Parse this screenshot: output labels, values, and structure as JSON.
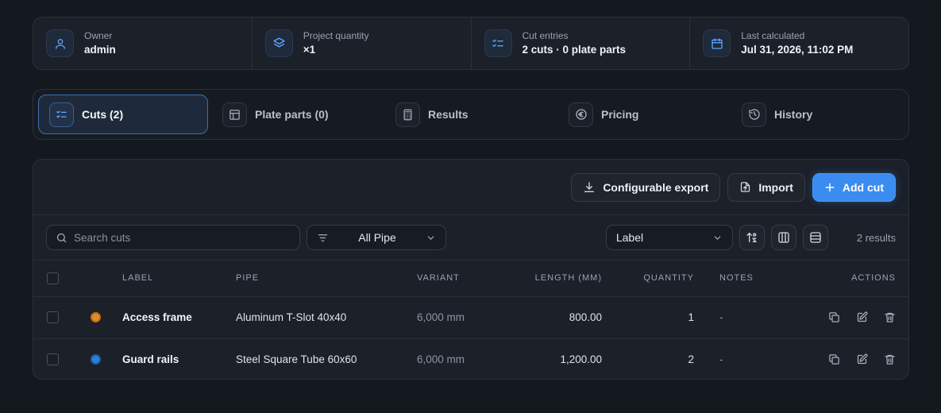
{
  "summary": [
    {
      "icon": "user-icon",
      "label": "Owner",
      "value": "admin"
    },
    {
      "icon": "layers-icon",
      "label": "Project quantity",
      "value": "×1"
    },
    {
      "icon": "list-check-icon",
      "label": "Cut entries",
      "value": "2 cuts · 0 plate parts"
    },
    {
      "icon": "calendar-icon",
      "label": "Last calculated",
      "value": "Jul 31, 2026, 11:02 PM"
    }
  ],
  "tabs": [
    {
      "label": "Cuts (2)",
      "icon": "list-check-icon",
      "active": true
    },
    {
      "label": "Plate parts (0)",
      "icon": "layout-icon",
      "active": false
    },
    {
      "label": "Results",
      "icon": "calculator-icon",
      "active": false
    },
    {
      "label": "Pricing",
      "icon": "euro-icon",
      "active": false
    },
    {
      "label": "History",
      "icon": "history-icon",
      "active": false
    }
  ],
  "actions": {
    "export_label": "Configurable export",
    "import_label": "Import",
    "add_label": "Add cut"
  },
  "filters": {
    "search_placeholder": "Search cuts",
    "pipe_filter": "All Pipe",
    "sort_field": "Label",
    "results": "2 results"
  },
  "table": {
    "headers": [
      "LABEL",
      "PIPE",
      "VARIANT",
      "LENGTH (MM)",
      "QUANTITY",
      "NOTES",
      "ACTIONS"
    ],
    "rows": [
      {
        "color": "#e08a2e",
        "label": "Access frame",
        "pipe": "Aluminum T-Slot 40x40",
        "variant": "6,000 mm",
        "length": "800.00",
        "quantity": "1",
        "notes": "-"
      },
      {
        "color": "#2f7fd6",
        "label": "Guard rails",
        "pipe": "Steel Square Tube 60x60",
        "variant": "6,000 mm",
        "length": "1,200.00",
        "quantity": "2",
        "notes": "-"
      }
    ]
  },
  "colors": {
    "accent": "#3b8cf0",
    "background": "#14181f",
    "panel": "#1b2029"
  }
}
